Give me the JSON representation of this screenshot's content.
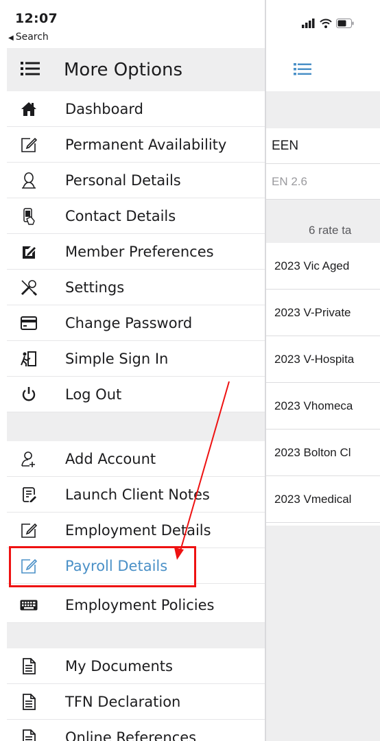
{
  "status": {
    "time": "12:07",
    "back_label": "Search"
  },
  "menu": {
    "title": "More Options",
    "group1": [
      {
        "label": "Dashboard",
        "icon": "home-icon"
      },
      {
        "label": "Permanent Availability",
        "icon": "edit-icon"
      },
      {
        "label": "Personal Details",
        "icon": "user-icon"
      },
      {
        "label": "Contact Details",
        "icon": "contact-phone-icon"
      },
      {
        "label": "Member Preferences",
        "icon": "edit-filled-icon"
      },
      {
        "label": "Settings",
        "icon": "tools-icon"
      },
      {
        "label": "Change Password",
        "icon": "credit-card-icon"
      },
      {
        "label": "Simple Sign In",
        "icon": "sign-in-icon"
      },
      {
        "label": "Log Out",
        "icon": "power-icon"
      }
    ],
    "group2": [
      {
        "label": "Add Account",
        "icon": "add-user-icon"
      },
      {
        "label": "Launch Client Notes",
        "icon": "notes-icon"
      },
      {
        "label": "Employment Details",
        "icon": "edit-icon"
      },
      {
        "label": "Payroll Details",
        "icon": "edit-icon",
        "active": true
      },
      {
        "label": "Employment Policies",
        "icon": "keyboard-icon"
      }
    ],
    "group3": [
      {
        "label": "My Documents",
        "icon": "document-icon"
      },
      {
        "label": "TFN Declaration",
        "icon": "document-icon"
      },
      {
        "label": "Online References",
        "icon": "document-icon"
      }
    ]
  },
  "panel": {
    "row_een": "EEN",
    "row_en": "EN 2.6",
    "rate_count": "6 rate ta",
    "rates": [
      "2023 Vic Aged",
      "2023 V-Private",
      "2023 V-Hospita",
      "2023 Vhomeca",
      "2023 Bolton Cl",
      "2023 Vmedical"
    ]
  },
  "colors": {
    "accent": "#4a90c7",
    "annotation": "#ee1111",
    "section_gray": "#eeeeef"
  }
}
